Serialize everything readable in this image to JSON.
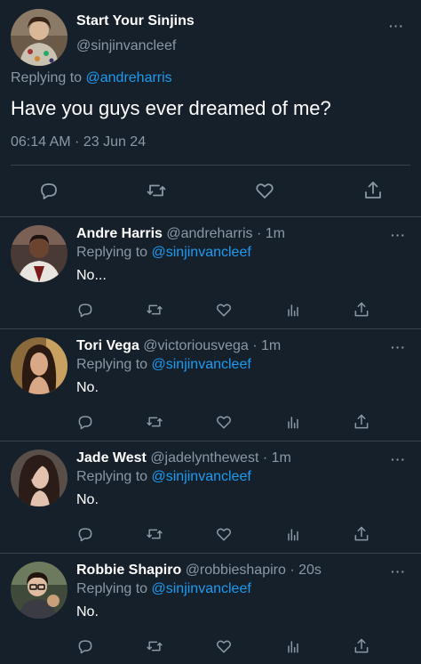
{
  "colors": {
    "background": "#15202b",
    "link": "#1d9bf0",
    "muted": "#8b98a5",
    "divider": "#38444d"
  },
  "main_tweet": {
    "name": "Start Your Sinjins",
    "handle": "@sinjinvancleef",
    "replying_prefix": "Replying to ",
    "replying_to": "@andreharris",
    "text": "Have you guys ever dreamed of me?",
    "timestamp": "06:14 AM · 23 Jun 24",
    "more_label": "···",
    "actions": [
      "reply-icon",
      "retweet-icon",
      "like-icon",
      "share-icon"
    ]
  },
  "replies": [
    {
      "name": "Andre Harris",
      "handle": "@andreharris · 1m",
      "replying_prefix": "Replying to ",
      "replying_to": "@sinjinvancleef",
      "text": "No...",
      "more_label": "···"
    },
    {
      "name": "Tori Vega",
      "handle": "@victoriousvega · 1m",
      "replying_prefix": "Replying to ",
      "replying_to": "@sinjinvancleef",
      "text": "No.",
      "more_label": "···"
    },
    {
      "name": "Jade West",
      "handle": "@jadelynthewest · 1m",
      "replying_prefix": "Replying to ",
      "replying_to": "@sinjinvancleef",
      "text": "No.",
      "more_label": "···"
    },
    {
      "name": "Robbie Shapiro",
      "handle": "@robbieshapiro · 20s",
      "replying_prefix": "Replying to ",
      "replying_to": "@sinjinvancleef",
      "text": "No.",
      "more_label": "···"
    }
  ],
  "reply_actions": [
    "reply-icon",
    "retweet-icon",
    "like-icon",
    "analytics-icon",
    "share-icon"
  ]
}
